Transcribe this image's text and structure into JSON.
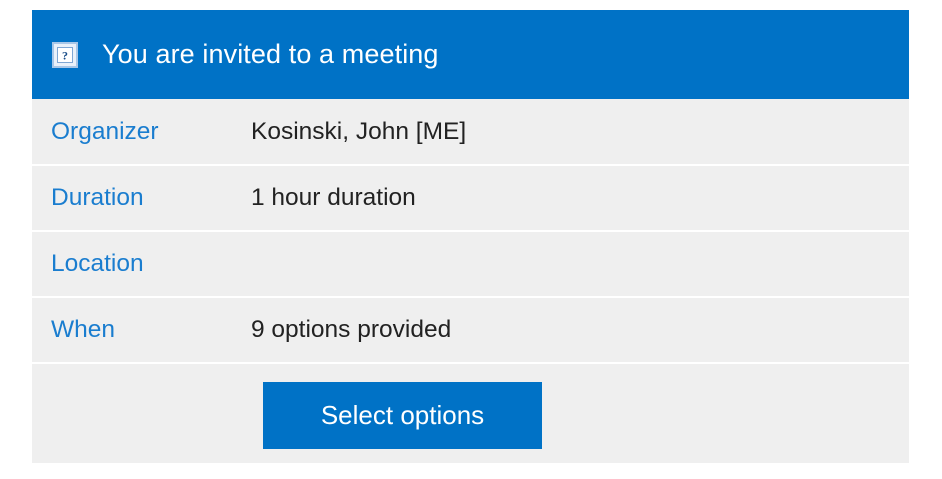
{
  "header": {
    "title": "You are invited to a meeting",
    "icon": "question-icon"
  },
  "details": [
    {
      "label": "Organizer",
      "value": "Kosinski, John [ME]"
    },
    {
      "label": "Duration",
      "value": "1 hour duration"
    },
    {
      "label": "Location",
      "value": ""
    },
    {
      "label": "When",
      "value": "9 options provided"
    }
  ],
  "actions": {
    "select_options_label": "Select options"
  },
  "colors": {
    "accent": "#0072c6",
    "label": "#1a7dcf",
    "row_background": "#efefef",
    "value_text": "#222222"
  }
}
